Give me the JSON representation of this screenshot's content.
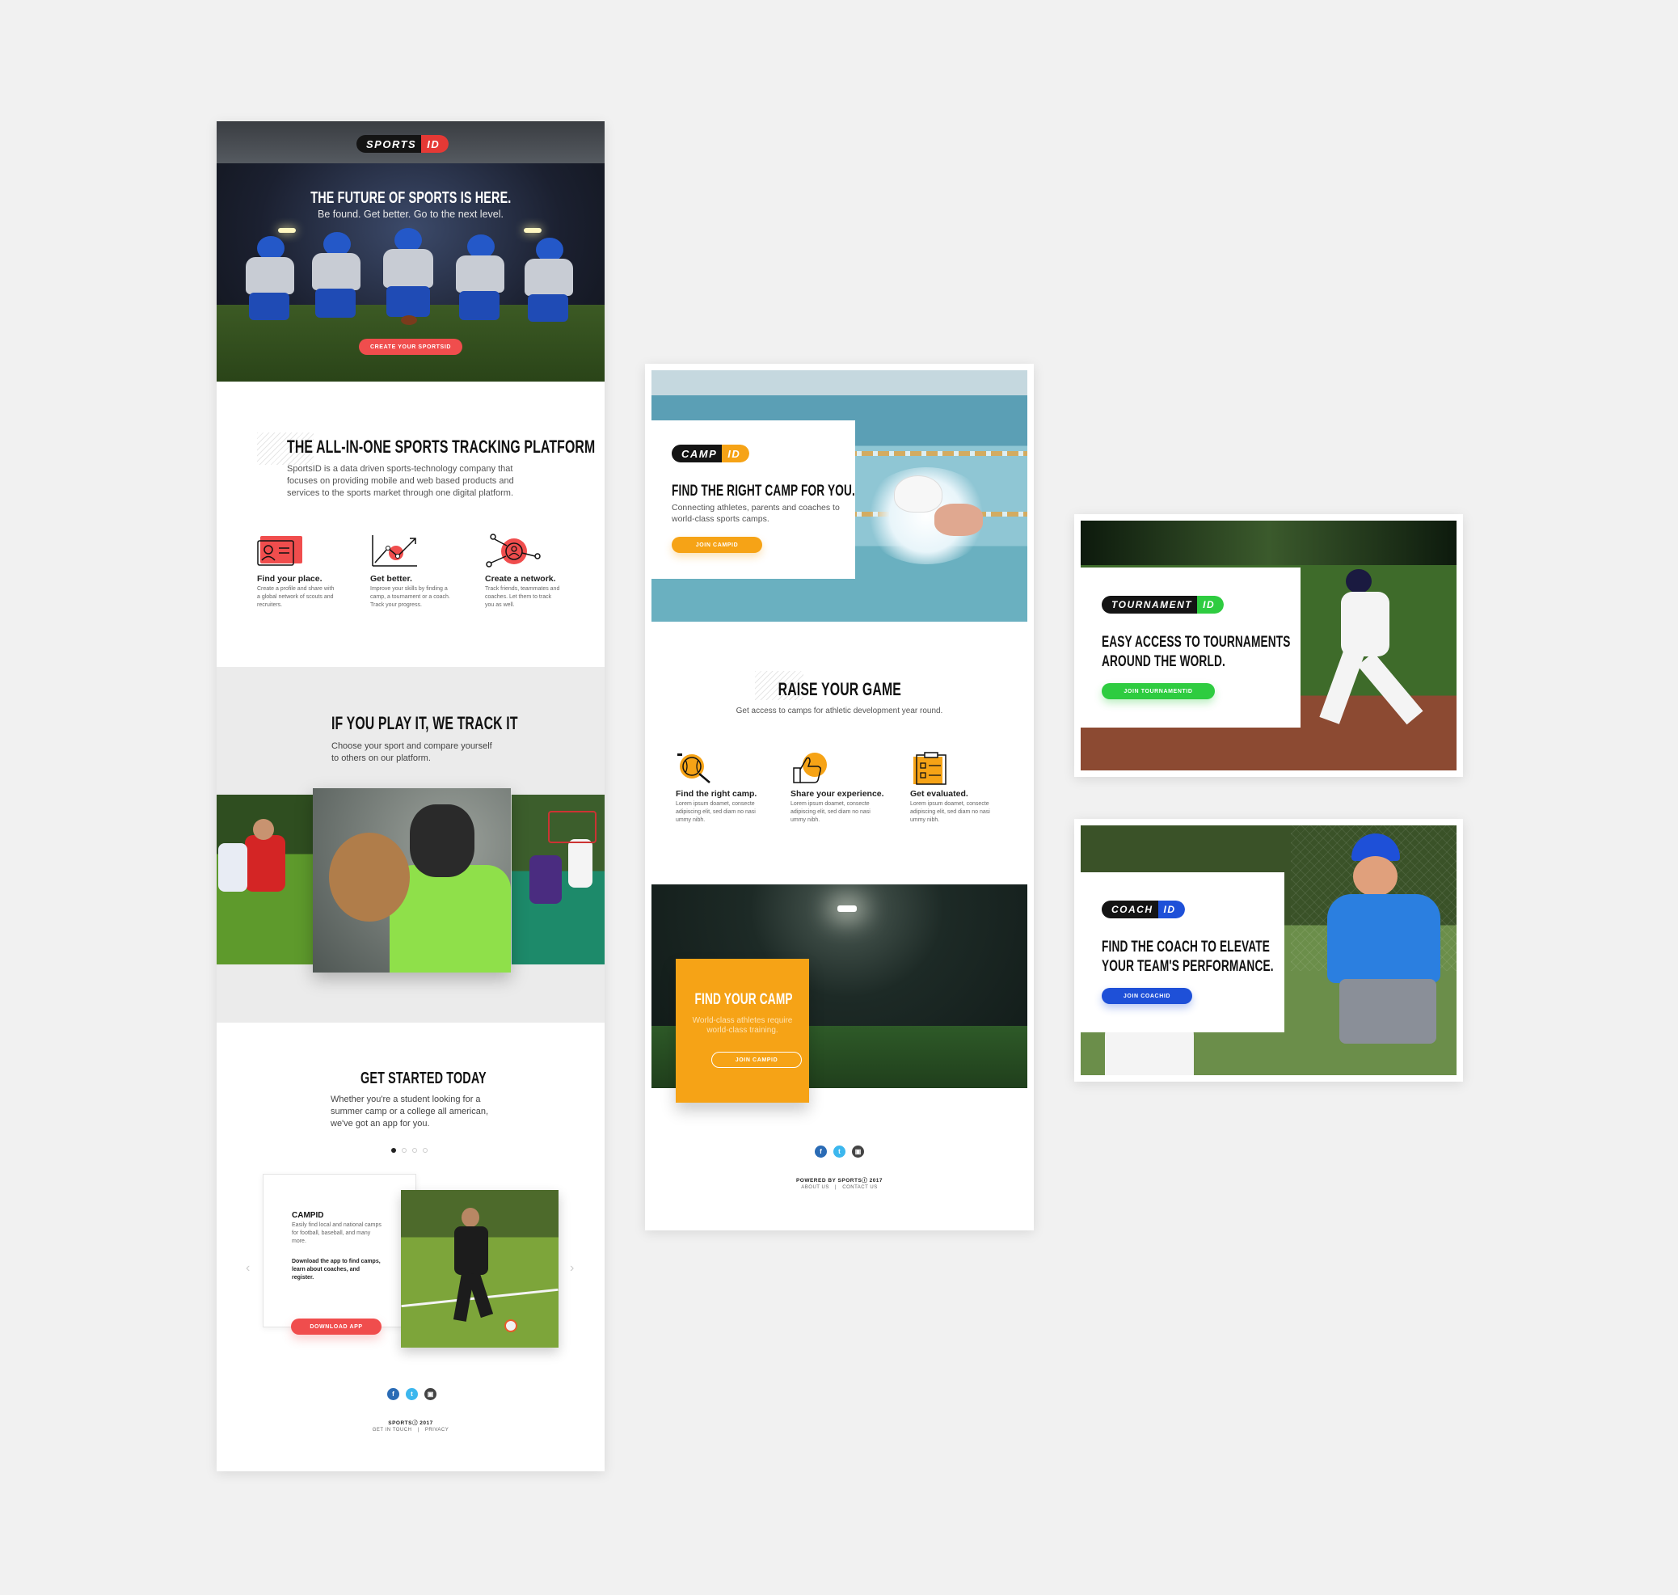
{
  "main_page": {
    "logo": {
      "word": "SPORTS",
      "id": "ID"
    },
    "hero": {
      "title": "THE FUTURE OF SPORTS IS HERE.",
      "subtitle": "Be found. Get better. Go to the next level.",
      "cta": "CREATE YOUR SPORTSID"
    },
    "platform": {
      "title": "THE ALL-IN-ONE SPORTS TRACKING PLATFORM",
      "body": "SportsID is a data driven sports-technology company that focuses on providing mobile and web based products and services to the sports market through one digital platform.",
      "features": [
        {
          "title": "Find your place.",
          "text": "Create a profile and share with a global network of scouts and recruiters.",
          "icon": "profile-card-icon"
        },
        {
          "title": "Get better.",
          "text": "Improve your skills by finding a camp, a tournament or a coach. Track your progress.",
          "icon": "growth-chart-icon"
        },
        {
          "title": "Create a network.",
          "text": "Track friends, teammates and coaches. Let them to track you as well.",
          "icon": "network-icon"
        }
      ]
    },
    "track": {
      "title": "IF YOU PLAY IT, WE TRACK IT",
      "body": "Choose your sport and compare yourself to others on our platform."
    },
    "get_started": {
      "title": "GET STARTED TODAY",
      "body": "Whether you're a student looking for a summer camp or a college all american, we've got an app for you.",
      "card": {
        "title": "CAMPID",
        "text": "Easily find local and national camps for football, baseball, and many more.",
        "bold": "Download the app to find camps, learn about coaches, and register.",
        "cta": "DOWNLOAD APP"
      }
    },
    "footer": {
      "copyright": "SPORTSⓘ 2017",
      "links": [
        "GET IN TOUCH",
        "PRIVACY"
      ]
    }
  },
  "camp_page": {
    "logo": {
      "word": "CAMP",
      "id": "ID"
    },
    "hero": {
      "title": "FIND THE RIGHT CAMP FOR YOU.",
      "body": "Connecting athletes, parents and coaches to world-class sports camps.",
      "cta": "JOIN CAMPID"
    },
    "raise": {
      "title": "RAISE YOUR GAME",
      "body": "Get access to camps for athletic development year round.",
      "features": [
        {
          "title": "Find the right camp.",
          "text": "Lorem ipsum doamet, consecte adipiscing elit, sed diam no nasi ummy nibh.",
          "icon": "baseball-search-icon"
        },
        {
          "title": "Share your experience.",
          "text": "Lorem ipsum doamet, consecte adipiscing elit, sed diam no nasi ummy nibh.",
          "icon": "thumbs-up-icon"
        },
        {
          "title": "Get evaluated.",
          "text": "Lorem ipsum doamet, consecte adipiscing elit, sed diam no nasi ummy nibh.",
          "icon": "clipboard-icon"
        }
      ]
    },
    "find": {
      "title": "FIND YOUR CAMP",
      "body": "World-class athletes require world-class training.",
      "cta": "JOIN CAMPID"
    },
    "footer": {
      "powered": "POWERED BY SPORTSⓘ 2017",
      "links": [
        "ABOUT US",
        "CONTACT US"
      ]
    }
  },
  "tournament_card": {
    "logo": {
      "word": "TOURNAMENT",
      "id": "ID"
    },
    "title": "EASY ACCESS TO TOURNAMENTS AROUND THE WORLD.",
    "cta": "JOIN TOURNAMENTID"
  },
  "coach_card": {
    "logo": {
      "word": "COACH",
      "id": "ID"
    },
    "title": "FIND THE COACH TO ELEVATE YOUR TEAM'S PERFORMANCE.",
    "cta": "JOIN COACHID"
  },
  "colors": {
    "sports_red": "#f04d4d",
    "camp_orange": "#f6a316",
    "tournament_green": "#2ecc40",
    "coach_blue": "#1e50d8",
    "facebook": "#2a6bb5",
    "twitter": "#3cb7ee",
    "instagram": "#333333"
  }
}
